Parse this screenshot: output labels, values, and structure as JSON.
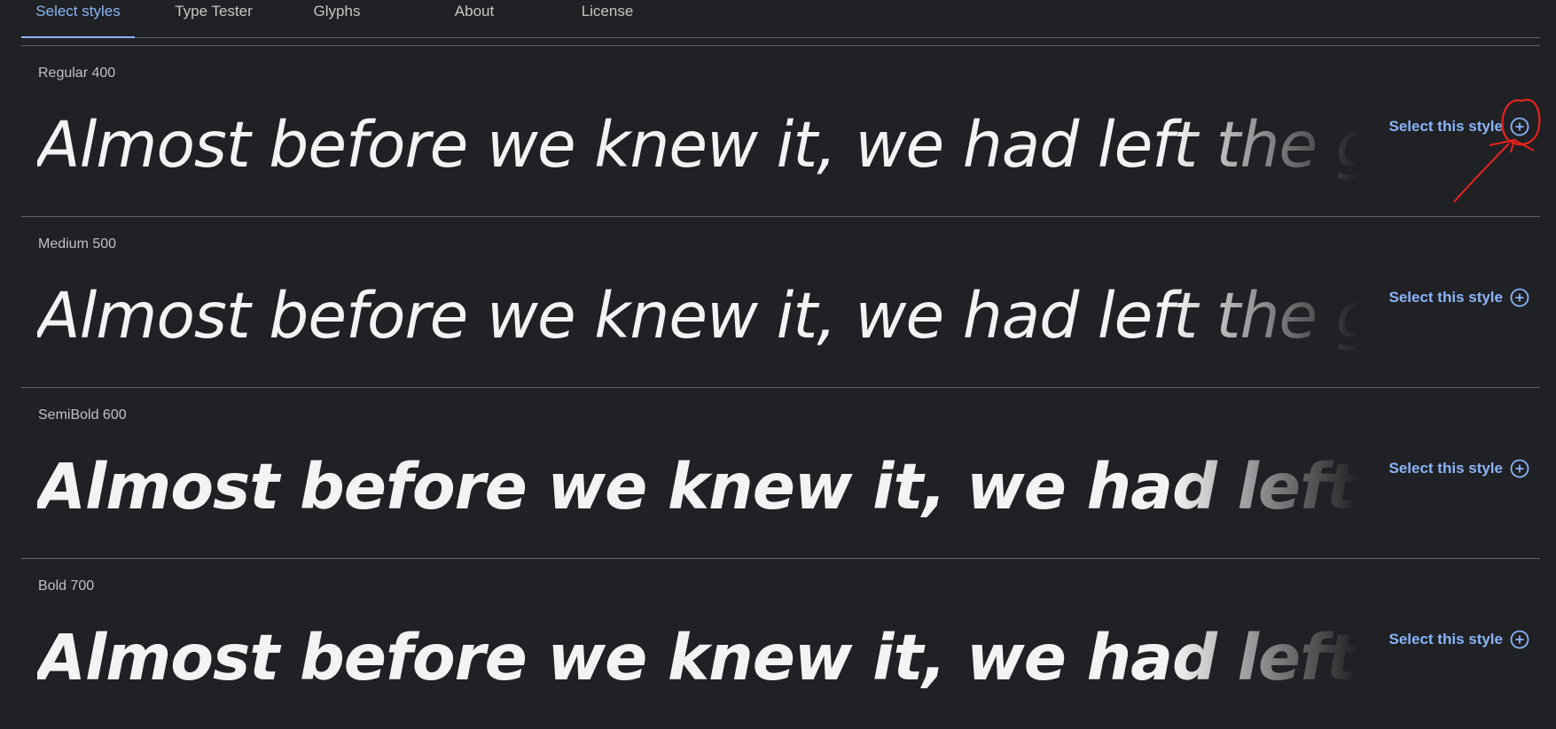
{
  "tabs": [
    {
      "label": "Select styles",
      "active": true
    },
    {
      "label": "Type Tester",
      "active": false
    },
    {
      "label": "Glyphs",
      "active": false
    },
    {
      "label": "About",
      "active": false
    },
    {
      "label": "License",
      "active": false
    }
  ],
  "styles": [
    {
      "label": "Regular 400",
      "sample": "Almost before we knew it, we had left the ground.",
      "button": "Select this style"
    },
    {
      "label": "Medium 500",
      "sample": "Almost before we knew it, we had left the ground.",
      "button": "Select this style"
    },
    {
      "label": "SemiBold 600",
      "sample": "Almost before we knew it, we had left the ground.",
      "button": "Select this style"
    },
    {
      "label": "Bold 700",
      "sample": "Almost before we knew it, we had left the ground.",
      "button": "Select this style"
    }
  ],
  "icons": {
    "select": "add-circle-icon"
  },
  "colors": {
    "background": "#202124",
    "accent": "#8ab4f8",
    "annotation": "#e8231f"
  }
}
